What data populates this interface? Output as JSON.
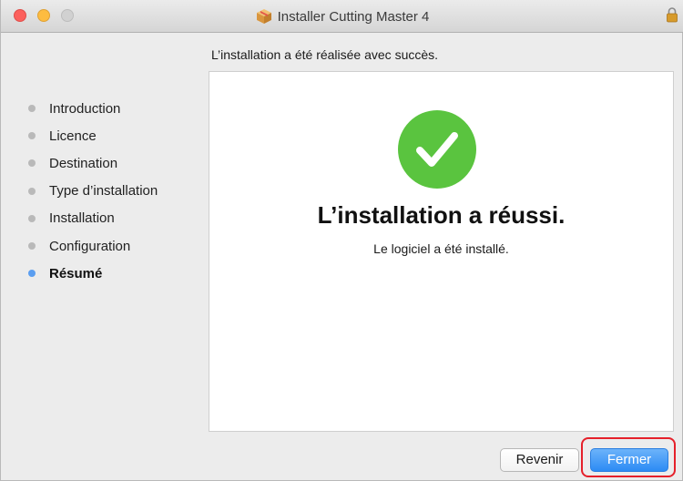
{
  "window": {
    "title": "Installer Cutting Master 4",
    "title_icon": "package-icon",
    "lock_icon": "lock-icon"
  },
  "header": {
    "status_text": "L’installation a été réalisée avec succès."
  },
  "sidebar": {
    "steps": [
      {
        "label": "Introduction",
        "active": false
      },
      {
        "label": "Licence",
        "active": false
      },
      {
        "label": "Destination",
        "active": false
      },
      {
        "label": "Type d’installation",
        "active": false
      },
      {
        "label": "Installation",
        "active": false
      },
      {
        "label": "Configuration",
        "active": false
      },
      {
        "label": "Résumé",
        "active": true
      }
    ]
  },
  "panel": {
    "icon": "checkmark-icon",
    "title": "L’installation a réussi.",
    "subtitle": "Le logiciel a été installé."
  },
  "buttons": {
    "back_label": "Revenir",
    "close_label": "Fermer"
  },
  "colors": {
    "success_green": "#5ac43f",
    "accent_blue": "#2c8bf4",
    "active_dot": "#5b9ef0",
    "highlight_red": "#e5202a"
  }
}
